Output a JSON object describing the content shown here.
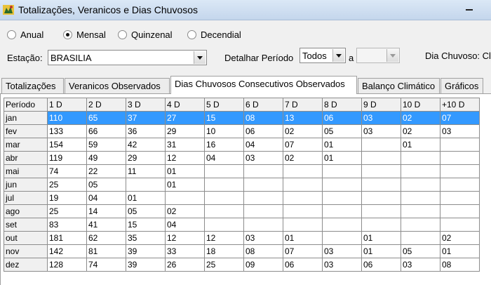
{
  "window": {
    "title": "Totalizações, Veranicos e Dias Chuvosos"
  },
  "period_options": [
    {
      "label": "Anual",
      "checked": false
    },
    {
      "label": "Mensal",
      "checked": true
    },
    {
      "label": "Quinzenal",
      "checked": false
    },
    {
      "label": "Decendial",
      "checked": false
    }
  ],
  "station": {
    "label": "Estação:",
    "value": "BRASILIA"
  },
  "detail": {
    "label": "Detalhar Período",
    "value": "Todos",
    "separator": "a",
    "to_value": ""
  },
  "rainy_day": {
    "label": "Dia Chuvoso: Cl"
  },
  "tabs": [
    {
      "label": "Totalizações",
      "active": false
    },
    {
      "label": "Veranicos Observados",
      "active": false
    },
    {
      "label": "Dias Chuvosos Consecutivos Observados",
      "active": true
    },
    {
      "label": "Balanço Climático",
      "active": false
    },
    {
      "label": "Gráficos",
      "active": false
    }
  ],
  "grid": {
    "columns": [
      "Período",
      "1 D",
      "2 D",
      "3 D",
      "4 D",
      "5 D",
      "6 D",
      "7 D",
      "8 D",
      "9 D",
      "10 D",
      "+10 D"
    ],
    "selected_row": 0,
    "rows": [
      [
        "jan",
        "110",
        "65",
        "37",
        "27",
        "15",
        "08",
        "13",
        "06",
        "03",
        "02",
        "07"
      ],
      [
        "fev",
        "133",
        "66",
        "36",
        "29",
        "10",
        "06",
        "02",
        "05",
        "03",
        "02",
        "03"
      ],
      [
        "mar",
        "154",
        "59",
        "42",
        "31",
        "16",
        "04",
        "07",
        "01",
        "",
        "01",
        ""
      ],
      [
        "abr",
        "119",
        "49",
        "29",
        "12",
        "04",
        "03",
        "02",
        "01",
        "",
        "",
        ""
      ],
      [
        "mai",
        "74",
        "22",
        "11",
        "01",
        "",
        "",
        "",
        "",
        "",
        "",
        ""
      ],
      [
        "jun",
        "25",
        "05",
        "",
        "01",
        "",
        "",
        "",
        "",
        "",
        "",
        ""
      ],
      [
        "jul",
        "19",
        "04",
        "01",
        "",
        "",
        "",
        "",
        "",
        "",
        "",
        ""
      ],
      [
        "ago",
        "25",
        "14",
        "05",
        "02",
        "",
        "",
        "",
        "",
        "",
        "",
        ""
      ],
      [
        "set",
        "83",
        "41",
        "15",
        "04",
        "",
        "",
        "",
        "",
        "",
        "",
        ""
      ],
      [
        "out",
        "181",
        "62",
        "35",
        "12",
        "12",
        "03",
        "01",
        "",
        "01",
        "",
        "02"
      ],
      [
        "nov",
        "142",
        "81",
        "39",
        "33",
        "18",
        "08",
        "07",
        "03",
        "01",
        "05",
        "01"
      ],
      [
        "dez",
        "128",
        "74",
        "39",
        "26",
        "25",
        "09",
        "06",
        "03",
        "06",
        "03",
        "08"
      ]
    ]
  }
}
